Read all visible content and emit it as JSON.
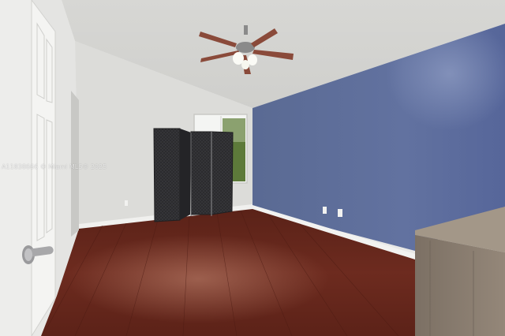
{
  "photo": {
    "watermark": "A11838666 © Miami MLS® 2025",
    "colors": {
      "accent_wall": "#5e6e97",
      "ceiling": "#d9d9d6",
      "wall_light": "#dcdcd9",
      "floor": "#6a2a1e",
      "door": "#f0f0ee",
      "divider": "#2b2b2e",
      "cabinet": "#8a7d6f"
    },
    "icons": [
      "ceiling-fan-icon",
      "door-handle-icon",
      "window-icon",
      "room-divider-icon",
      "outlet-icon"
    ]
  }
}
